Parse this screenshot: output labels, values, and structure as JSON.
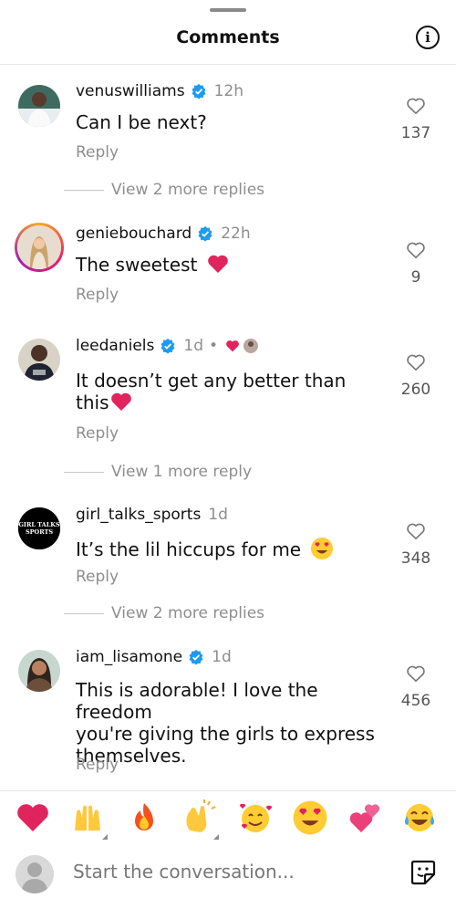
{
  "header": {
    "title": "Comments",
    "info_icon": "i"
  },
  "comments": [
    {
      "username": "venuswilliams",
      "verified": true,
      "time": "12h",
      "text": "Can I be next?",
      "reply_label": "Reply",
      "likes": "137",
      "more_replies": "View 2 more replies"
    },
    {
      "username": "geniebouchard",
      "verified": true,
      "time": "22h",
      "text": "The sweetest",
      "reply_label": "Reply",
      "likes": "9"
    },
    {
      "username": "leedaniels",
      "verified": true,
      "time": "1d",
      "text_line1": "It doesn’t get any better than",
      "text_line2": "this",
      "reply_label": "Reply",
      "likes": "260",
      "more_replies": "View 1 more reply"
    },
    {
      "username": "girl_talks_sports",
      "verified": false,
      "time": "1d",
      "text": "It’s the lil hiccups for me",
      "avatar_text_1": "GIRL TALKS",
      "avatar_text_2": "SPORTS",
      "reply_label": "Reply",
      "likes": "348",
      "more_replies": "View 2 more replies"
    },
    {
      "username": "iam_lisamone",
      "verified": true,
      "time": "1d",
      "text_line1": "This is adorable! I love the freedom",
      "text_line2": "you're giving the girls to express",
      "text_line3": "themselves.",
      "reply_label": "Reply",
      "likes": "456"
    }
  ],
  "emoji_bar": [
    "red-heart",
    "raising-hands",
    "fire",
    "clapping-hands",
    "smiling-face-with-hearts",
    "heart-eyes",
    "two-hearts",
    "tears-of-joy"
  ],
  "composer": {
    "placeholder": "Start the conversation..."
  },
  "colors": {
    "verified": "#1d9bf0",
    "heart": "#e0245e",
    "muted": "#8e8e8e"
  }
}
